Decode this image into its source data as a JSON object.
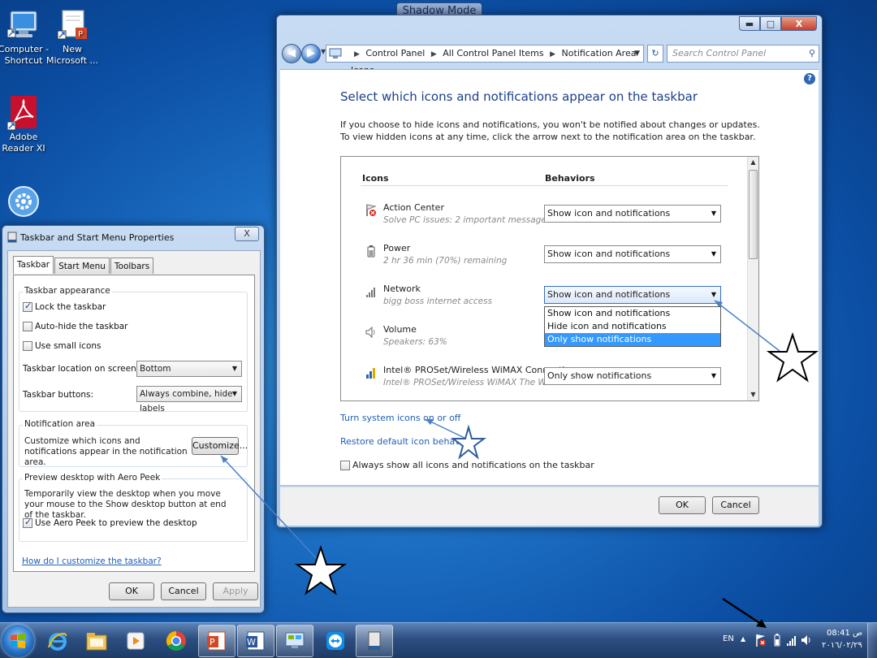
{
  "desktop": {
    "icons": [
      {
        "label": "Computer - Shortcut"
      },
      {
        "label": "New Microsoft ..."
      },
      {
        "label": "Adobe Reader XI"
      },
      {
        "label": ""
      }
    ],
    "shadow_mode": "Shadow Mode"
  },
  "control_panel": {
    "window_buttons": {
      "minimize": "▬",
      "maximize": "□",
      "close": "X"
    },
    "breadcrumb": [
      "Control Panel",
      "All Control Panel Items",
      "Notification Area Icons"
    ],
    "search_placeholder": "Search Control Panel",
    "help": "?",
    "title": "Select which icons and notifications appear on the taskbar",
    "description": "If you choose to hide icons and notifications, you won't be notified about changes or updates. To view hidden icons at any time, click the arrow next to the notification area on the taskbar.",
    "table": {
      "col_icons": "Icons",
      "col_behaviors": "Behaviors",
      "rows": [
        {
          "name": "Action Center",
          "sub": "Solve PC issues: 2 important messages",
          "behavior": "Show icon and notifications",
          "icon": "flag-error-icon"
        },
        {
          "name": "Power",
          "sub": "2 hr 36 min (70%) remaining",
          "behavior": "Show icon and notifications",
          "icon": "battery-icon"
        },
        {
          "name": "Network",
          "sub": "bigg boss internet access",
          "behavior": "Show icon and notifications",
          "icon": "network-signal-icon"
        },
        {
          "name": "Volume",
          "sub": "Speakers: 63%",
          "behavior": "",
          "icon": "speaker-icon"
        },
        {
          "name": "Intel® PROSet/Wireless WiMAX Connecti...",
          "sub": "Intel® PROSet/Wireless WiMAX  The WiM...",
          "behavior": "Only show notifications",
          "icon": "wimax-icon"
        }
      ],
      "dropdown_options": [
        "Show icon and notifications",
        "Hide icon and notifications",
        "Only show notifications"
      ],
      "dropdown_highlight": 2
    },
    "link_system_icons": "Turn system icons on or off",
    "link_restore": "Restore default icon behaviors",
    "always_show_label": "Always show all icons and notifications on the taskbar",
    "always_show_checked": false,
    "ok": "OK",
    "cancel": "Cancel"
  },
  "taskbar_properties": {
    "title": "Taskbar and Start Menu Properties",
    "close": "X",
    "tabs": [
      "Taskbar",
      "Start Menu",
      "Toolbars"
    ],
    "active_tab": 0,
    "appearance_group": "Taskbar appearance",
    "lock_taskbar": "Lock the taskbar",
    "lock_checked": true,
    "auto_hide": "Auto-hide the taskbar",
    "auto_hide_checked": false,
    "small_icons": "Use small icons",
    "small_icons_checked": false,
    "location_label": "Taskbar location on screen:",
    "location_value": "Bottom",
    "buttons_label": "Taskbar buttons:",
    "buttons_value": "Always combine, hide labels",
    "notification_group": "Notification area",
    "notification_text": "Customize which icons and notifications appear in the notification area.",
    "customize": "Customize...",
    "peek_group": "Preview desktop with Aero Peek",
    "peek_text": "Temporarily view the desktop when you move your mouse to the Show desktop button at end of the taskbar.",
    "peek_label": "Use Aero Peek to preview the desktop",
    "peek_checked": true,
    "help_link": "How do I customize the taskbar?",
    "ok": "OK",
    "cancel": "Cancel",
    "apply": "Apply"
  },
  "taskbar": {
    "lang": "EN",
    "show_hidden": "▲",
    "time": "08:41 ص",
    "date": "٢٠١٦/٠٢/٢٩",
    "pinned": [
      "start-orb-icon",
      "internet-explorer-icon",
      "file-explorer-icon",
      "media-player-icon",
      "chrome-icon",
      "powerpoint-icon",
      "word-icon",
      "control-panel-icon",
      "teamviewer-icon",
      "taskbar-properties-icon"
    ]
  },
  "colors": {
    "accent": "#1b3f8b",
    "link": "#1f5fb7",
    "highlight": "#3399ff",
    "desktop": "#1c6fc4"
  }
}
